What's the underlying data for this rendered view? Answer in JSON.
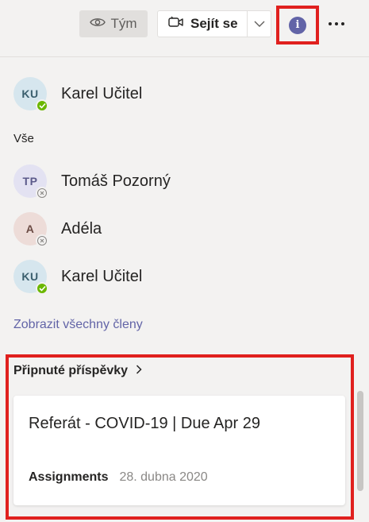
{
  "toolbar": {
    "team_label": "Tým",
    "meet_label": "Sejít se",
    "info_glyph": "i",
    "icons": {
      "team": "eye-icon",
      "meet": "video-camera-icon",
      "meet_dropdown": "chevron-down-icon",
      "info": "info-icon",
      "more": "more-options-icon"
    }
  },
  "owners": [
    {
      "initials": "KU",
      "name": "Karel Učitel",
      "presence": "available"
    }
  ],
  "members_section_label": "Vše",
  "members": [
    {
      "initials": "TP",
      "name": "Tomáš Pozorný",
      "presence": "offline"
    },
    {
      "initials": "A",
      "name": "Adéla",
      "presence": "offline"
    },
    {
      "initials": "KU",
      "name": "Karel Učitel",
      "presence": "available"
    }
  ],
  "show_all_members_label": "Zobrazit všechny členy",
  "pinned": {
    "title": "Připnuté příspěvky",
    "card": {
      "title": "Referát - COVID-19 | Due Apr 29",
      "source": "Assignments",
      "date": "28. dubna 2020"
    }
  },
  "colors": {
    "accent": "#6264a7",
    "available": "#6bb700",
    "highlight": "#e0201e"
  }
}
